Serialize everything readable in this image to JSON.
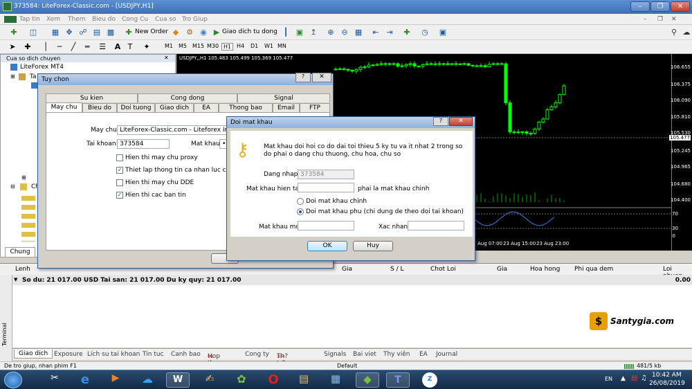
{
  "window": {
    "title": "373584: LiteForex-Classic.com - [USDJPY,H1]"
  },
  "menu": [
    "Tap tin",
    "Xem",
    "Them",
    "Bieu do",
    "Cong Cu",
    "Cua so",
    "Tro Giup"
  ],
  "toolbar": {
    "new_order": "New Order",
    "auto_trade": "Giao dich tu dong"
  },
  "timeframes": [
    "M1",
    "M5",
    "M15",
    "M30",
    "H1",
    "H4",
    "D1",
    "W1",
    "MN"
  ],
  "navigator": {
    "header": "Cua so dich chuyen",
    "root": "LiteForex MT4",
    "item_ta": "Ta",
    "item_ch": "Ch",
    "tab_common": "Chung"
  },
  "chart": {
    "symbol_info": "USDJPY,,H1  105.483 105.499 105.369 105.477",
    "price_labels": [
      "106.655",
      "106.375",
      "106.090",
      "105.810",
      "105.530",
      "105.477",
      "105.245",
      "104.965",
      "104.680",
      "104.400"
    ],
    "current_price": "105.477",
    "osc_labels": [
      "70",
      "30",
      "0"
    ],
    "time_labels": [
      "Aug 07:00",
      "23 Aug 15:00",
      "23 Aug 23:00"
    ]
  },
  "options_dialog": {
    "title": "Tuy chon",
    "tabs_row1": [
      "Su kien",
      "Cong dong",
      "Signal"
    ],
    "tabs_row2": [
      "May chu",
      "Bieu do",
      "Doi tuong",
      "Giao dich",
      "EA",
      "Thong bao",
      "Email",
      "FTP"
    ],
    "server_label": "May chu:",
    "server_value": "LiteForex-Classic.com - Liteforex Investments",
    "account_label": "Tai khoan:",
    "account_value": "373584",
    "password_label": "Mat khau:",
    "password_value": "••",
    "checkboxes": [
      {
        "label": "Hien thi may chu proxy",
        "checked": false
      },
      {
        "label": "Thiet lap thong tin ca nhan luc cai dat",
        "checked": true
      },
      {
        "label": "Hien thi may chu DDE",
        "checked": false
      },
      {
        "label": "Hien thi cac ban tin",
        "checked": true
      }
    ]
  },
  "password_dialog": {
    "title": "Doi mat khau",
    "description": "Mat khau doi hoi co do dai toi thieu 5 ky tu va it nhat 2 trong so do phai o dang chu thuong, chu hoa, chu so",
    "login_label": "Dang nhap:",
    "login_value": "373584",
    "current_label": "Mat khau hien tai:",
    "current_note": "phai la mat khau chinh",
    "radio_main": "Doi mat khau chinh",
    "radio_sub": "Doi mat khau phu (chi dung de theo doi tai khoan)",
    "selected": "sub",
    "new_label": "Mat khau moi:",
    "confirm_label": "Xac nhan:",
    "ok": "OK",
    "cancel": "Huy"
  },
  "terminal": {
    "columns": [
      "Lenh",
      "Gia",
      "S / L",
      "Chot Loi",
      "Gia",
      "Hoa hong",
      "Phi qua dem",
      "Loi nhuan"
    ],
    "balance_row": "So du: 21 017.00 USD  Tai san: 21 017.00  Du ky quy: 21 017.00",
    "profit": "0.00",
    "side_label": "Terminal",
    "tabs": [
      "Giao dich",
      "Exposure",
      "Lich su tai khoan",
      "Tin tuc",
      "Canh bao",
      "Hop thu",
      "Cong ty",
      "Th? tr?ng",
      "Signals",
      "Bai viet",
      "Thy viên",
      "EA",
      "Journal"
    ],
    "mailbox_count": "56",
    "market_count": "104"
  },
  "statusbar": {
    "help": "De tro giup, nhan phim F1",
    "profile": "Default",
    "traffic": "481/5 kb"
  },
  "watermark": "Santygia.com",
  "taskbar": {
    "lang": "EN",
    "time": "10:42 AM",
    "date": "26/08/2019"
  }
}
